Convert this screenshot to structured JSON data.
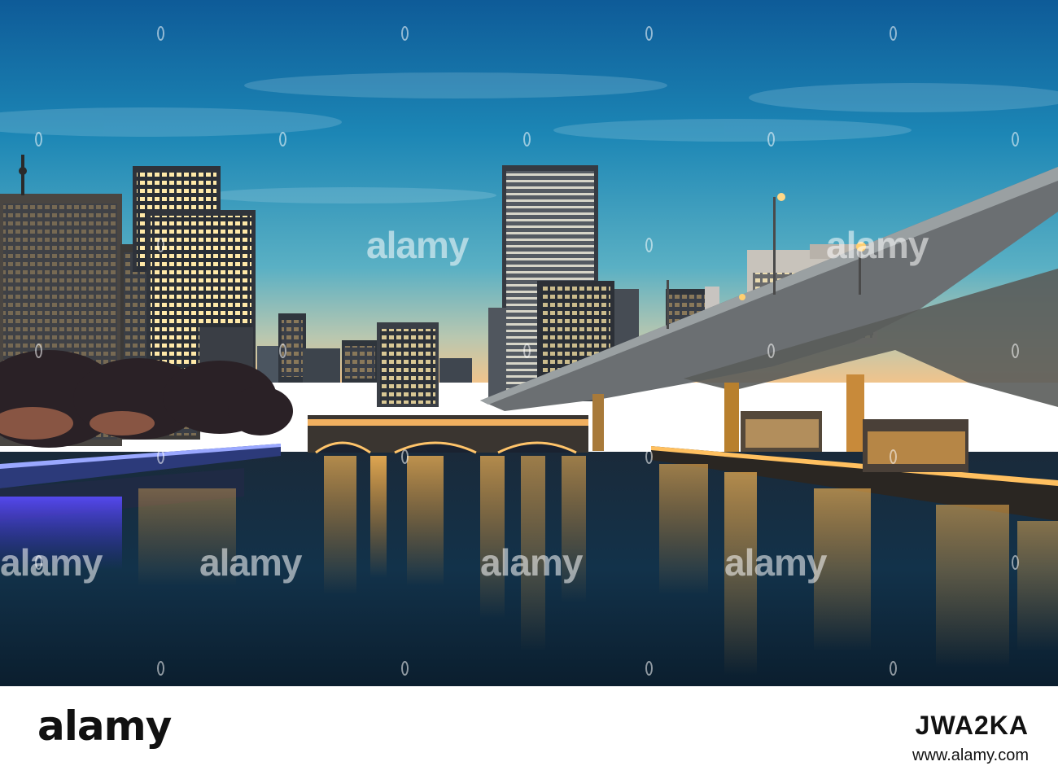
{
  "watermark": {
    "text": "alamy"
  },
  "footer": {
    "logo": "alamy",
    "image_id": "JWA2KA",
    "url": "www.alamy.com"
  },
  "colors": {
    "sky_top": "#0f5f9a",
    "sky_horizon": "#f2c891",
    "water": "#0f2434",
    "light_gold": "#ffb340",
    "light_blue": "#3b3bff"
  }
}
